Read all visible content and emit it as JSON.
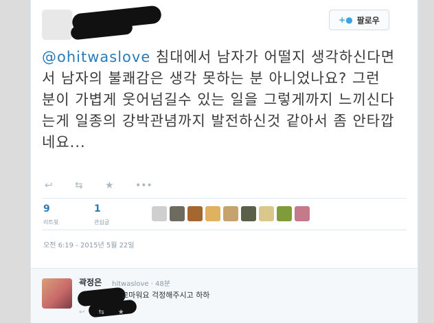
{
  "follow_button": {
    "icon": "add-user-icon",
    "label": "팔로우"
  },
  "tweet": {
    "mention": "@ohitwaslove",
    "text": " 침대에서 남자가 어떨지 생각하신다면서 남자의 불쾌감은 생각 못하는 분 아니었나요? 그런 분이 가볍게 웃어넘길수 있는 일을 그렇게까지 느끼신다는게 일종의 강박관념까지 발전하신것 같아서 좀 안타깝네요..."
  },
  "actions": {
    "reply_icon": "reply-icon",
    "retweet_icon": "retweet-icon",
    "favorite_icon": "star-icon",
    "more_icon": "more-icon"
  },
  "stats": {
    "retweets": {
      "count": "9",
      "label": "리트윗"
    },
    "favorites": {
      "count": "1",
      "label": "관심글"
    }
  },
  "likers_colors": [
    "#cfcfcf",
    "#6d6a5f",
    "#a5672f",
    "#e0b15e",
    "#c6a26e",
    "#58604a",
    "#d9c889",
    "#7f9b3a",
    "#c57a8c"
  ],
  "timestamp": "오전 6:19 - 2015년 5월 22일",
  "reply": {
    "name": "곽정은",
    "meta": "hitwaslove · 48분",
    "text": "고마워요 걱정해주시고 하하"
  }
}
